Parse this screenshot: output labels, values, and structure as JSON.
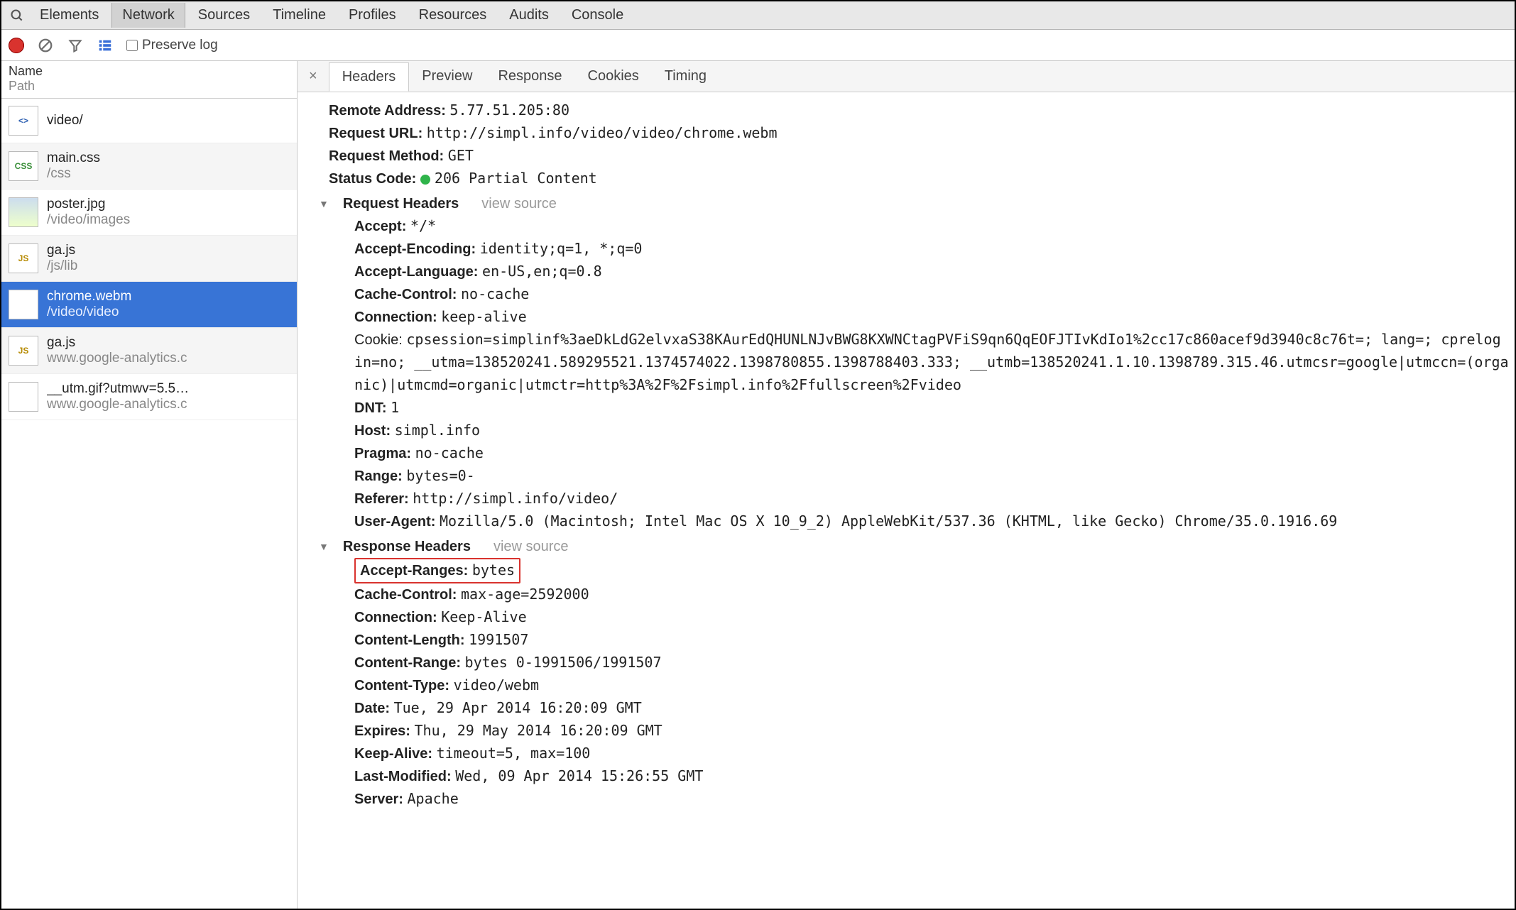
{
  "topTabs": [
    "Elements",
    "Network",
    "Sources",
    "Timeline",
    "Profiles",
    "Resources",
    "Audits",
    "Console"
  ],
  "topTabsActive": "Network",
  "toolbar": {
    "preserveLogLabel": "Preserve log"
  },
  "sidebar": {
    "header": {
      "name": "Name",
      "path": "Path"
    },
    "items": [
      {
        "type": "html",
        "name": "video/",
        "path": ""
      },
      {
        "type": "css",
        "name": "main.css",
        "path": "/css"
      },
      {
        "type": "img",
        "name": "poster.jpg",
        "path": "/video/images"
      },
      {
        "type": "js",
        "name": "ga.js",
        "path": "/js/lib"
      },
      {
        "type": "file",
        "name": "chrome.webm",
        "path": "/video/video",
        "selected": true
      },
      {
        "type": "js",
        "name": "ga.js",
        "path": "www.google-analytics.c"
      },
      {
        "type": "file",
        "name": "__utm.gif?utmwv=5.5…",
        "path": "www.google-analytics.c"
      }
    ]
  },
  "detailTabs": [
    "Headers",
    "Preview",
    "Response",
    "Cookies",
    "Timing"
  ],
  "detailTabsActive": "Headers",
  "summary": {
    "remoteAddressLabel": "Remote Address:",
    "remoteAddress": "5.77.51.205:80",
    "requestUrlLabel": "Request URL:",
    "requestUrl": "http://simpl.info/video/video/chrome.webm",
    "requestMethodLabel": "Request Method:",
    "requestMethod": "GET",
    "statusCodeLabel": "Status Code:",
    "statusCode": "206 Partial Content"
  },
  "sections": {
    "request": {
      "title": "Request Headers",
      "viewSource": "view source"
    },
    "response": {
      "title": "Response Headers",
      "viewSource": "view source"
    }
  },
  "requestHeaders": {
    "accept": {
      "k": "Accept:",
      "v": "*/*"
    },
    "acceptEncoding": {
      "k": "Accept-Encoding:",
      "v": "identity;q=1, *;q=0"
    },
    "acceptLanguage": {
      "k": "Accept-Language:",
      "v": "en-US,en;q=0.8"
    },
    "cacheControl": {
      "k": "Cache-Control:",
      "v": "no-cache"
    },
    "connection": {
      "k": "Connection:",
      "v": "keep-alive"
    },
    "cookie": {
      "k": "Cookie:",
      "v": "cpsession=simplinf%3aeDkLdG2elvxaS38KAurEdQHUNLNJvBWG8KXWNCtagPVFiS9qn6QqEOFJTIvKdIo1%2cc17c860acef9d3940c8c76t=; lang=; cprelogin=no; __utma=138520241.589295521.1374574022.1398780855.1398788403.333; __utmb=138520241.1.10.1398789.315.46.utmcsr=google|utmccn=(organic)|utmcmd=organic|utmctr=http%3A%2F%2Fsimpl.info%2Ffullscreen%2Fvideo"
    },
    "dnt": {
      "k": "DNT:",
      "v": "1"
    },
    "host": {
      "k": "Host:",
      "v": "simpl.info"
    },
    "pragma": {
      "k": "Pragma:",
      "v": "no-cache"
    },
    "range": {
      "k": "Range:",
      "v": "bytes=0-"
    },
    "referer": {
      "k": "Referer:",
      "v": "http://simpl.info/video/"
    },
    "userAgent": {
      "k": "User-Agent:",
      "v": "Mozilla/5.0 (Macintosh; Intel Mac OS X 10_9_2) AppleWebKit/537.36 (KHTML, like Gecko) Chrome/35.0.1916.69"
    }
  },
  "responseHeaders": {
    "acceptRanges": {
      "k": "Accept-Ranges:",
      "v": "bytes"
    },
    "cacheControl": {
      "k": "Cache-Control:",
      "v": "max-age=2592000"
    },
    "connection": {
      "k": "Connection:",
      "v": "Keep-Alive"
    },
    "contentLength": {
      "k": "Content-Length:",
      "v": "1991507"
    },
    "contentRange": {
      "k": "Content-Range:",
      "v": "bytes 0-1991506/1991507"
    },
    "contentType": {
      "k": "Content-Type:",
      "v": "video/webm"
    },
    "date": {
      "k": "Date:",
      "v": "Tue, 29 Apr 2014 16:20:09 GMT"
    },
    "expires": {
      "k": "Expires:",
      "v": "Thu, 29 May 2014 16:20:09 GMT"
    },
    "keepAlive": {
      "k": "Keep-Alive:",
      "v": "timeout=5, max=100"
    },
    "lastModified": {
      "k": "Last-Modified:",
      "v": "Wed, 09 Apr 2014 15:26:55 GMT"
    },
    "server": {
      "k": "Server:",
      "v": "Apache"
    }
  }
}
